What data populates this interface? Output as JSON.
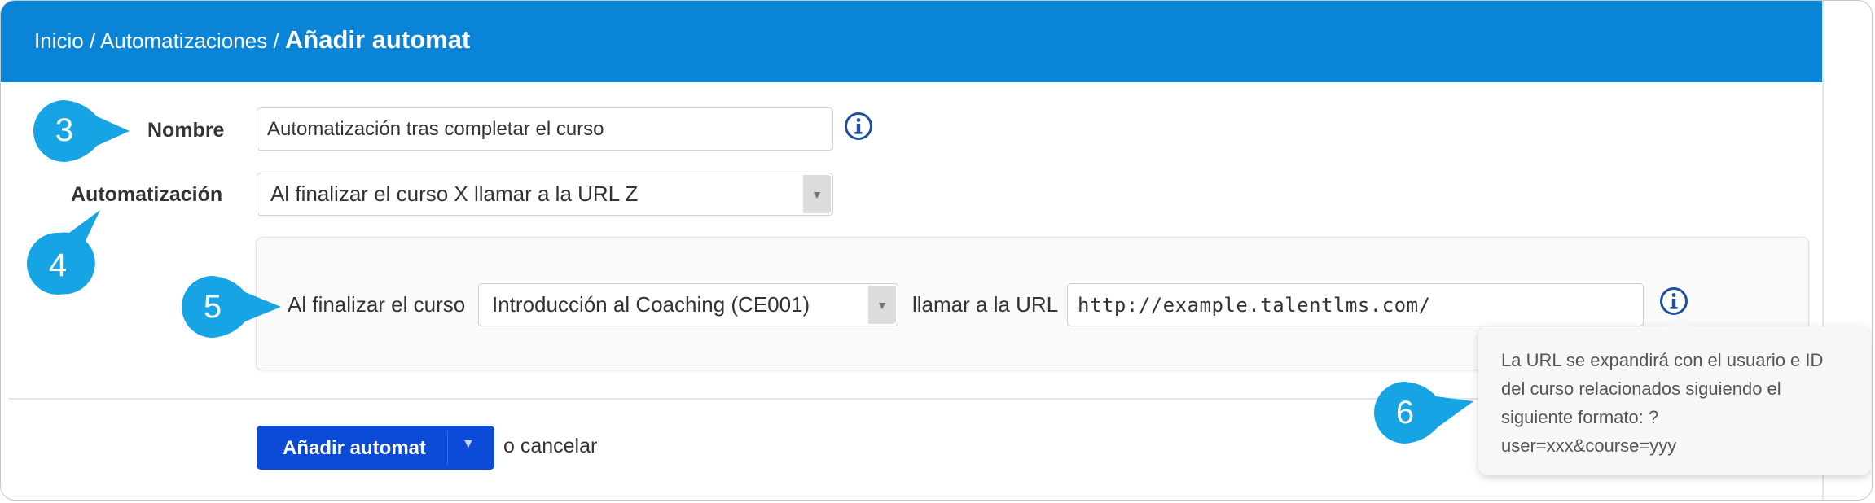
{
  "breadcrumb": {
    "home": "Inicio",
    "sep1": "/",
    "section": "Automatizaciones",
    "sep2": "/",
    "current": "Añadir automat"
  },
  "form": {
    "name_label": "Nombre",
    "name_value": "Automatización tras completar el curso",
    "automation_label": "Automatización",
    "automation_value": "Al finalizar el curso X llamar a la URL Z",
    "course_prefix": "Al finalizar el curso",
    "course_value": "Introducción al Coaching (CE001)",
    "url_prefix": "llamar a la URL",
    "url_value": "http://example.talentlms.com/"
  },
  "actions": {
    "submit_label": "Añadir automat",
    "cancel_label": "o cancelar"
  },
  "tooltip": {
    "lines": [
      "La URL se expandirá con el usuario e ID",
      "del curso relacionados siguiendo el",
      "siguiente formato: ?",
      "user=xxx&course=yyy"
    ]
  },
  "callouts": [
    "3",
    "4",
    "5",
    "6"
  ],
  "colors": {
    "header": "#0a84d6",
    "callout": "#16a4e4",
    "button": "#0c4bd8",
    "info_icon": "#1f4e9c"
  },
  "icons": [
    "info-icon",
    "dropdown-arrow-icon",
    "caret-down-icon"
  ]
}
